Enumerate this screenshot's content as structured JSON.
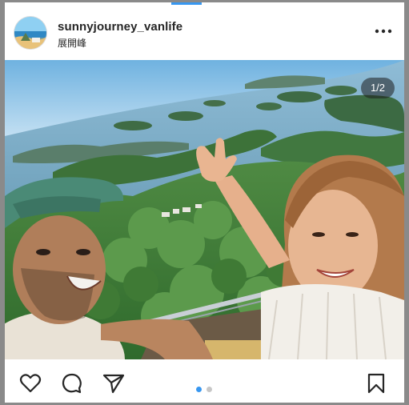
{
  "post": {
    "username": "sunnyjourney_vanlife",
    "location": "展開峰",
    "media_counter": "1/2",
    "carousel": {
      "total": 2,
      "active": 1
    }
  },
  "icons": {
    "more": "more-horizontal-icon",
    "like": "heart-icon",
    "comment": "comment-bubble-icon",
    "share": "paper-plane-icon",
    "save": "bookmark-icon"
  },
  "colors": {
    "accent": "#3897f0",
    "text": "#262626",
    "inactive_dot": "#a8a8a8"
  }
}
